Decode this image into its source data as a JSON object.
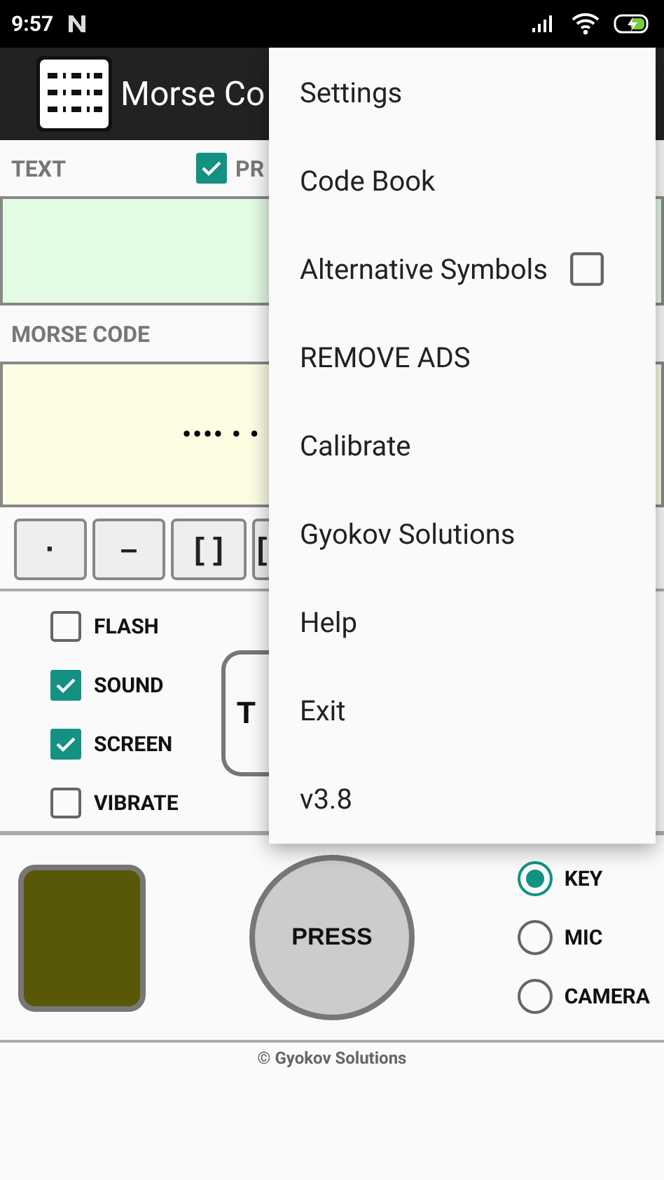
{
  "status_bar": {
    "time": "9:57"
  },
  "app_bar": {
    "title": "Morse Co"
  },
  "text_section": {
    "label": "TEXT",
    "option": {
      "label": "PR",
      "checked": true
    }
  },
  "morse_section": {
    "label": "MORSE CODE",
    "value": "•••• • •"
  },
  "keys": [
    "·",
    "–",
    "[ ]",
    "["
  ],
  "outputs": [
    {
      "label": "FLASH",
      "checked": false
    },
    {
      "label": "SOUND",
      "checked": true
    },
    {
      "label": "SCREEN",
      "checked": true
    },
    {
      "label": "VIBRATE",
      "checked": false
    }
  ],
  "big_button": {
    "label": "T"
  },
  "press_button": {
    "label": "PRESS"
  },
  "inputs": [
    {
      "label": "KEY",
      "selected": true
    },
    {
      "label": "MIC",
      "selected": false
    },
    {
      "label": "CAMERA",
      "selected": false
    }
  ],
  "footer": "© Gyokov Solutions",
  "menu": [
    {
      "label": "Settings",
      "kind": "plain"
    },
    {
      "label": "Code Book",
      "kind": "plain"
    },
    {
      "label": "Alternative Symbols",
      "kind": "checkbox",
      "checked": false
    },
    {
      "label": "REMOVE ADS",
      "kind": "plain"
    },
    {
      "label": "Calibrate",
      "kind": "plain"
    },
    {
      "label": "Gyokov Solutions",
      "kind": "plain"
    },
    {
      "label": "Help",
      "kind": "plain"
    },
    {
      "label": "Exit",
      "kind": "plain"
    },
    {
      "label": "v3.8",
      "kind": "plain"
    }
  ]
}
